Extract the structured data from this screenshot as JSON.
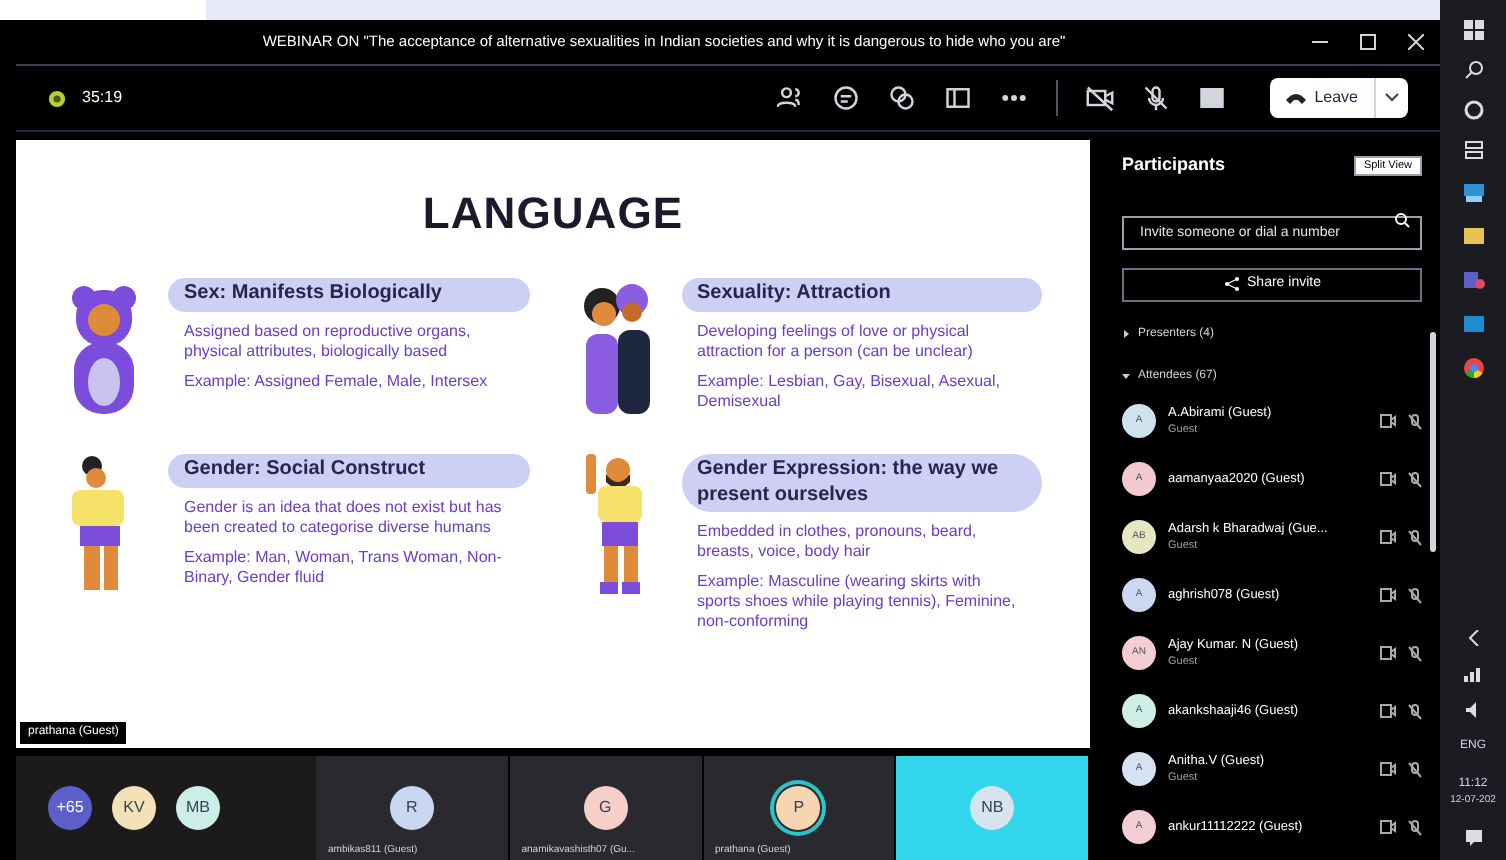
{
  "title_bar": {
    "title": "WEBINAR ON \"The acceptance of alternative sexualities in Indian societies and why it is dangerous to hide who you are\""
  },
  "toolbar": {
    "timer": "35:19",
    "leave": "Leave"
  },
  "slide": {
    "title": "LANGUAGE",
    "presenter_label": "prathana (Guest)",
    "sections": [
      {
        "heading": "Sex: Manifests Biologically",
        "description": "Assigned based on reproductive organs, physical attributes, biologically based",
        "example": "Example: Assigned Female, Male, Intersex"
      },
      {
        "heading": "Sexuality: Attraction",
        "description": "Developing feelings of love or physical attraction for a person (can be unclear)",
        "example": "Example: Lesbian, Gay, Bisexual, Asexual, Demisexual"
      },
      {
        "heading": "Gender: Social Construct",
        "description": "Gender is an idea that does not exist but has been created to categorise diverse humans",
        "example": "Example: Man, Woman, Trans Woman, Non- Binary, Gender fluid"
      },
      {
        "heading": "Gender Expression: the way we present ourselves",
        "description": "Embedded in clothes, pronouns, beard, breasts, voice, body hair",
        "example": "Example: Masculine (wearing skirts with sports shoes while playing tennis), Feminine, non-conforming"
      }
    ]
  },
  "participants": {
    "title": "Participants",
    "tooltip": "Split View",
    "search_placeholder": "Invite someone or dial a number",
    "share_invite": "Share invite",
    "groups": [
      {
        "label": "Presenters (4)",
        "expanded": false
      },
      {
        "label": "Attendees (67)",
        "expanded": true
      }
    ],
    "people": [
      {
        "name": "A.Abirami (Guest)",
        "subtitle": "Guest",
        "initials": "A",
        "color": "#cfe3ef"
      },
      {
        "name": "aamanyaa2020 (Guest)",
        "initials": "A",
        "color": "#f2c9cf"
      },
      {
        "name": "Adarsh k Bharadwaj (Gue...",
        "subtitle": "Guest",
        "initials": "AB",
        "color": "#e6e6c3"
      },
      {
        "name": "aghrish078 (Guest)",
        "initials": "A",
        "color": "#cdd8f0"
      },
      {
        "name": "Ajay Kumar. N (Guest)",
        "subtitle": "Guest",
        "initials": "AN",
        "color": "#f2cdd3"
      },
      {
        "name": "akankshaaji46 (Guest)",
        "initials": "A",
        "color": "#cfeee6"
      },
      {
        "name": "Anitha.V (Guest)",
        "subtitle": "Guest",
        "initials": "A",
        "color": "#d6e2f2"
      },
      {
        "name": "ankur11112222 (Guest)",
        "initials": "A",
        "color": "#f2cdd3"
      }
    ]
  },
  "video_strip": {
    "avatars": [
      {
        "initials": "+65",
        "color": "#5b5fc7"
      },
      {
        "initials": "KV",
        "color": "#f3e2b8"
      },
      {
        "initials": "MB",
        "color": "#cdeee8"
      }
    ],
    "tiles": [
      {
        "initials": "R",
        "name": "ambikas811 (Guest)",
        "color": "#c9d8f0",
        "speaking": false
      },
      {
        "initials": "G",
        "name": "anamikavashisth07 (Gu...",
        "color": "#f6cfc8",
        "speaking": false
      },
      {
        "initials": "P",
        "name": "prathana (Guest)",
        "color": "#f6d6b0",
        "speaking": true
      },
      {
        "initials": "NB",
        "color": "#d7e3ee",
        "speaking": false
      }
    ]
  },
  "taskbar": {
    "language": "ENG",
    "time": "11:12",
    "date": "12-07-202"
  }
}
